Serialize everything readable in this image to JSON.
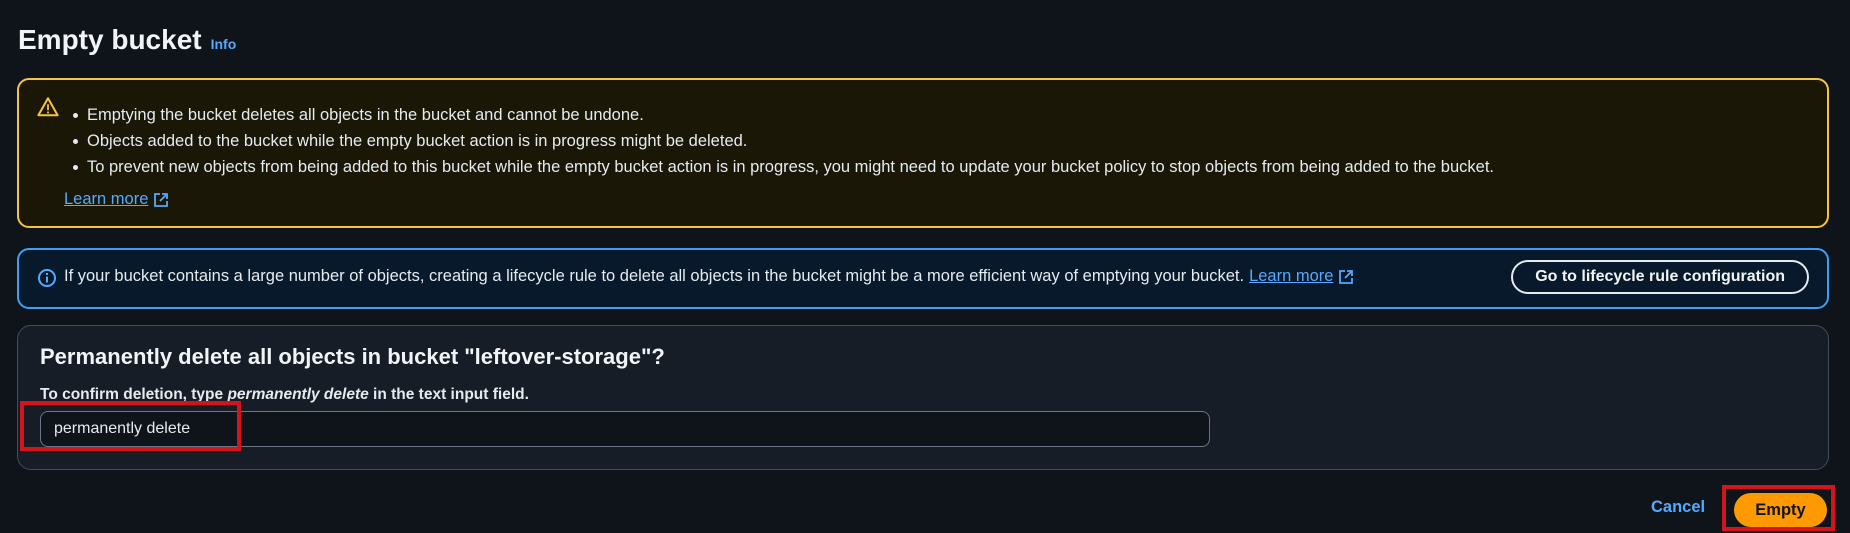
{
  "page": {
    "title": "Empty bucket",
    "info_label": "Info"
  },
  "warning": {
    "icon": "warning-icon",
    "items": [
      "Emptying the bucket deletes all objects in the bucket and cannot be undone.",
      "Objects added to the bucket while the empty bucket action is in progress might be deleted.",
      "To prevent new objects from being added to this bucket while the empty bucket action is in progress, you might need to update your bucket policy to stop objects from being added to the bucket."
    ],
    "learn_more": "Learn more"
  },
  "info_alert": {
    "icon": "info-icon",
    "text": "If your bucket contains a large number of objects, creating a lifecycle rule to delete all objects in the bucket might be a more efficient way of emptying your bucket.",
    "learn_more": "Learn more",
    "button_label": "Go to lifecycle rule configuration"
  },
  "confirm": {
    "heading": "Permanently delete all objects in bucket \"leftover-storage\"?",
    "label_prefix": "To confirm deletion, type ",
    "label_keyword": "permanently delete",
    "label_suffix": " in the text input field.",
    "input_value": "permanently delete"
  },
  "actions": {
    "cancel_label": "Cancel",
    "empty_label": "Empty"
  },
  "colors": {
    "background": "#0f141a",
    "warning_border": "#f4c543",
    "info_border": "#3d9ff7",
    "link": "#56a9ff",
    "primary_button": "#ff9900",
    "highlight": "#d4141c"
  }
}
